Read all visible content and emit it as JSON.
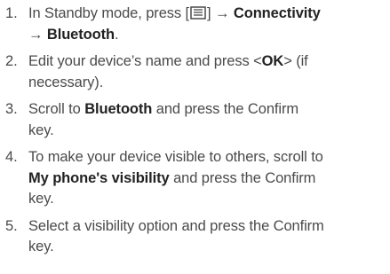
{
  "steps": [
    {
      "number": "1.",
      "pre": "In Standby mode, press [",
      "menu_key_icon": "menu-key-icon",
      "mid": "] → ",
      "kw1": "Connectivity",
      "mid2": "\n→ ",
      "kw2": "Bluetooth",
      "post": "."
    },
    {
      "number": "2.",
      "pre": "Edit your device’s name and press <",
      "kw1": "OK",
      "post": "> (if\nnecessary)."
    },
    {
      "number": "3.",
      "pre": "Scroll to ",
      "kw1": "Bluetooth",
      "post": " and press the Confirm\nkey."
    },
    {
      "number": "4.",
      "pre": "To make your device visible to others, scroll to\n",
      "kw1": "My phone's visibility",
      "post": " and press the Confirm\nkey."
    },
    {
      "number": "5.",
      "pre": "Select a visibility option and press the Confirm\nkey."
    }
  ]
}
